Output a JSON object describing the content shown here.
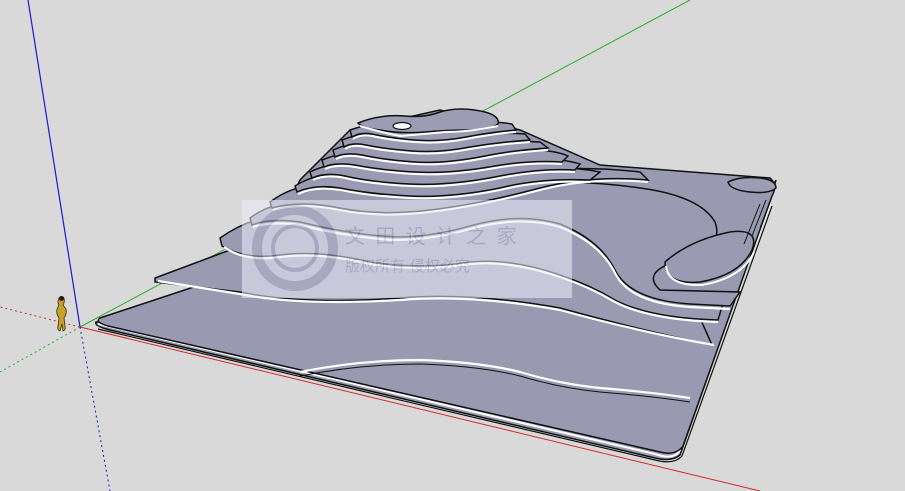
{
  "scene": {
    "background": "#d9d9d9",
    "surface_color": "#9b9bb4",
    "edge_color": "#111111",
    "highlight_color": "#ffffff",
    "axes": {
      "red": "#d22a2a",
      "green": "#27b02b",
      "blue": "#1a1ad0"
    },
    "model": "topographic-contour-terrain",
    "figure": "scale-figure-person"
  },
  "watermark": {
    "line1": "文 田 设 计 之 家",
    "line2": "版权所有 侵权必究",
    "color": "#c7c4dd"
  }
}
